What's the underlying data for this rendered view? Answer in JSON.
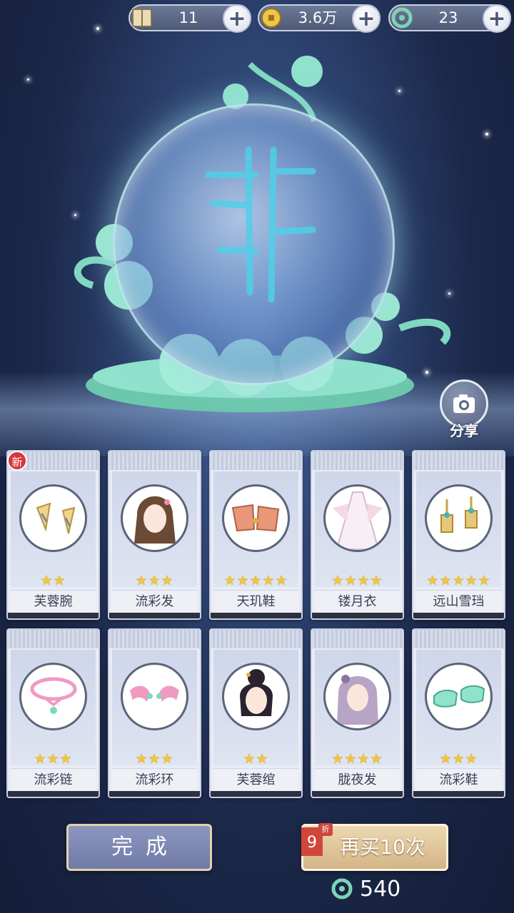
{
  "currencies": [
    {
      "icon": "book-icon",
      "value": "11"
    },
    {
      "icon": "coin-icon",
      "value": "3.6万"
    },
    {
      "icon": "jade-dragon-icon",
      "value": "23"
    }
  ],
  "share_label": "分享",
  "new_badge": "新",
  "items": [
    {
      "name": "芙蓉腕",
      "stars": "★★",
      "icon": "bracelet-icon"
    },
    {
      "name": "流彩发",
      "stars": "★★★",
      "icon": "hair-icon"
    },
    {
      "name": "天玑鞋",
      "stars": "★★★★★",
      "icon": "shoes-icon"
    },
    {
      "name": "镂月衣",
      "stars": "★★★★",
      "icon": "dress-icon"
    },
    {
      "name": "远山雪珰",
      "stars": "★★★★★",
      "icon": "earrings-icon"
    },
    {
      "name": "流彩链",
      "stars": "★★★",
      "icon": "necklace-icon"
    },
    {
      "name": "流彩环",
      "stars": "★★★",
      "icon": "bracelet-pair-icon"
    },
    {
      "name": "芙蓉绾",
      "stars": "★★",
      "icon": "hair-icon"
    },
    {
      "name": "胧夜发",
      "stars": "★★★★",
      "icon": "hair-icon"
    },
    {
      "name": "流彩鞋",
      "stars": "★★★",
      "icon": "shoes-icon"
    }
  ],
  "buttons": {
    "done_label": "完成",
    "buy_again_label": "再买10次",
    "discount_number": "9",
    "discount_suffix": "折",
    "cost_value": "540"
  }
}
